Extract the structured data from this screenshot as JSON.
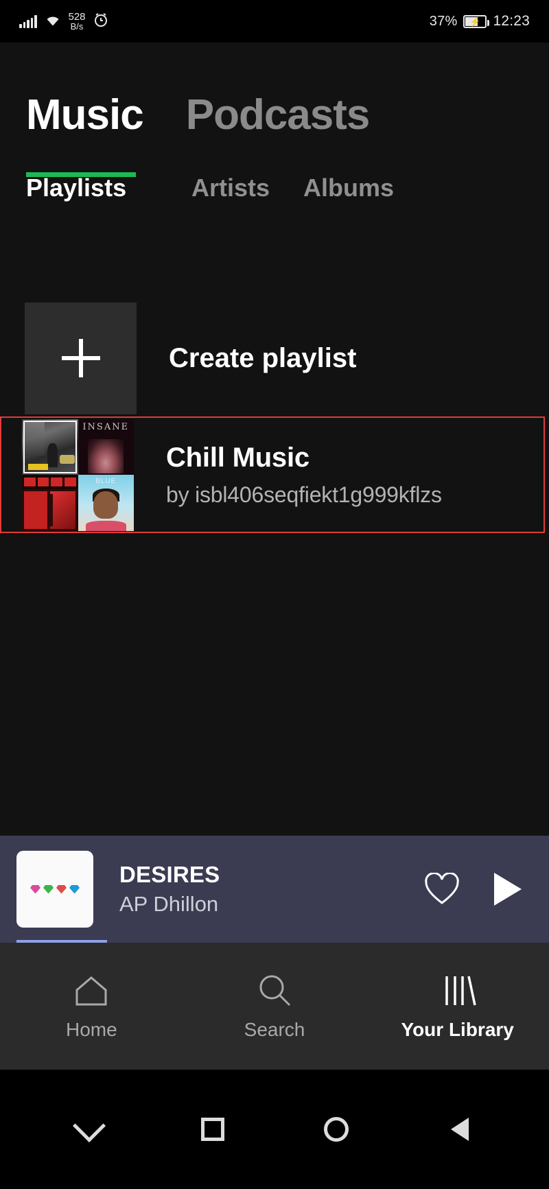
{
  "status_bar": {
    "network_speed_value": "528",
    "network_speed_unit": "B/s",
    "battery_percent": "37%",
    "clock": "12:23",
    "icons": [
      "signal-icon",
      "wifi-icon",
      "alarm-clock-icon",
      "battery-charging-icon"
    ]
  },
  "header": {
    "main_tabs": [
      {
        "label": "Music",
        "active": true
      },
      {
        "label": "Podcasts",
        "active": false
      }
    ],
    "sub_tabs": [
      {
        "label": "Playlists",
        "active": true
      },
      {
        "label": "Artists",
        "active": false
      },
      {
        "label": "Albums",
        "active": false
      }
    ],
    "active_indicator_color": "#1db954"
  },
  "library": {
    "create_playlist": {
      "label": "Create playlist",
      "icon": "plus-icon"
    },
    "playlists": [
      {
        "title": "Chill Music",
        "subtitle": "by isbl406seqfiekt1g999kflzs",
        "highlighted": true,
        "highlight_color": "#e23b3b",
        "cover_tiles": [
          "city-street-album",
          "insane-album",
          "toxic-album",
          "blue-sky-portrait-album"
        ]
      }
    ]
  },
  "now_playing": {
    "track_title": "DESIRES",
    "artist": "AP Dhillon",
    "background_color": "#3b3b52",
    "like_icon": "heart-icon",
    "play_icon": "play-icon",
    "artwork_icon": "gem-emojis-artwork"
  },
  "bottom_nav": [
    {
      "label": "Home",
      "icon": "home-icon",
      "active": false
    },
    {
      "label": "Search",
      "icon": "search-icon",
      "active": false
    },
    {
      "label": "Your Library",
      "icon": "library-icon",
      "active": true
    }
  ],
  "system_nav": [
    {
      "name": "collapse-keyboard-button",
      "icon": "chevron-down-icon"
    },
    {
      "name": "recents-button",
      "icon": "square-icon"
    },
    {
      "name": "home-button",
      "icon": "circle-icon"
    },
    {
      "name": "back-button",
      "icon": "triangle-left-icon"
    }
  ]
}
